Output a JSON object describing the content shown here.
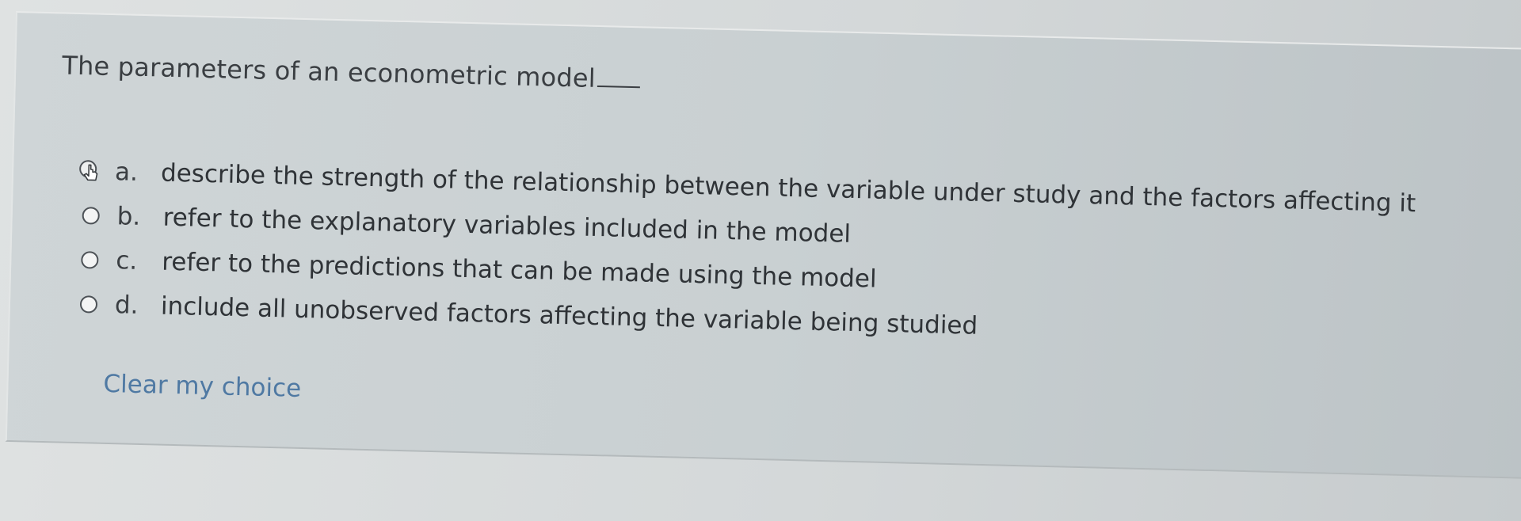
{
  "question": {
    "text": "The parameters of an econometric model"
  },
  "options": [
    {
      "letter": "a.",
      "text": "describe the strength of the relationship between the variable under study and the factors affecting it"
    },
    {
      "letter": "b.",
      "text": "refer to the explanatory variables included in the model"
    },
    {
      "letter": "c.",
      "text": "refer to the predictions that can be made using the model"
    },
    {
      "letter": "d.",
      "text": "include all unobserved factors affecting the variable being studied"
    }
  ],
  "clear_choice_label": "Clear my choice",
  "colors": {
    "text": "#3a3e42",
    "link": "#4f79a3",
    "card": "#cfd5d7"
  },
  "icons": {
    "cursor": "hand-pointer-icon",
    "radio": "radio-button-icon"
  }
}
